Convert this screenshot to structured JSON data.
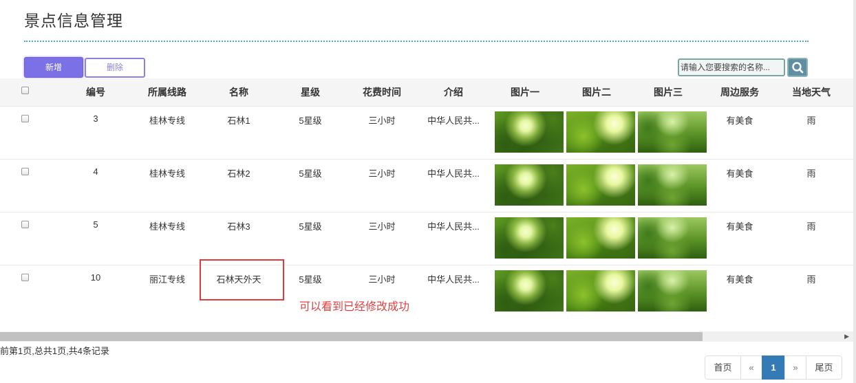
{
  "page": {
    "title": "景点信息管理"
  },
  "toolbar": {
    "add_label": "新增",
    "delete_label": "删除"
  },
  "search": {
    "placeholder": "请输入您要搜索的名称...",
    "button_icon": "search-icon"
  },
  "table": {
    "columns": [
      "编号",
      "所属线路",
      "名称",
      "星级",
      "花费时间",
      "介绍",
      "图片一",
      "图片二",
      "图片三",
      "周边服务",
      "当地天气"
    ],
    "rows": [
      {
        "id": "3",
        "route": "桂林专线",
        "name": "石林1",
        "stars": "5星级",
        "duration": "三小时",
        "intro": "中华人民共...",
        "service": "有美食",
        "weather": "雨"
      },
      {
        "id": "4",
        "route": "桂林专线",
        "name": "石林2",
        "stars": "5星级",
        "duration": "三小时",
        "intro": "中华人民共...",
        "service": "有美食",
        "weather": "雨"
      },
      {
        "id": "5",
        "route": "桂林专线",
        "name": "石林3",
        "stars": "5星级",
        "duration": "三小时",
        "intro": "中华人民共...",
        "service": "有美食",
        "weather": "雨"
      },
      {
        "id": "10",
        "route": "丽江专线",
        "name": "石林天外天",
        "stars": "5星级",
        "duration": "三小时",
        "intro": "中华人民共...",
        "service": "有美食",
        "weather": "雨"
      }
    ]
  },
  "annotation": {
    "text": "可以看到已经修改成功",
    "color": "#e04040"
  },
  "pagination": {
    "info": "前第1页,总共1页,共4条记录",
    "first": "首页",
    "prev": "«",
    "current": "1",
    "next": "»",
    "last": "尾页",
    "accent": "#337ab7"
  }
}
